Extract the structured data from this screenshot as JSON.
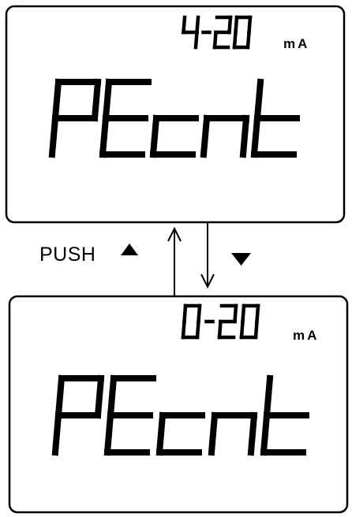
{
  "push": {
    "label": "PUSH"
  },
  "screens": [
    {
      "range_text": "4-20",
      "unit": "mA",
      "main_text": "PEcnt"
    },
    {
      "range_text": "0-20",
      "unit": "mA",
      "main_text": "PEcnt"
    }
  ],
  "icons": {
    "up": "up-arrow-icon",
    "down": "down-arrow-icon",
    "arrow_up_line": "up-arrow-line-icon",
    "arrow_down_line": "down-arrow-line-icon"
  },
  "colors": {
    "ink": "#000000",
    "background": "#ffffff"
  }
}
